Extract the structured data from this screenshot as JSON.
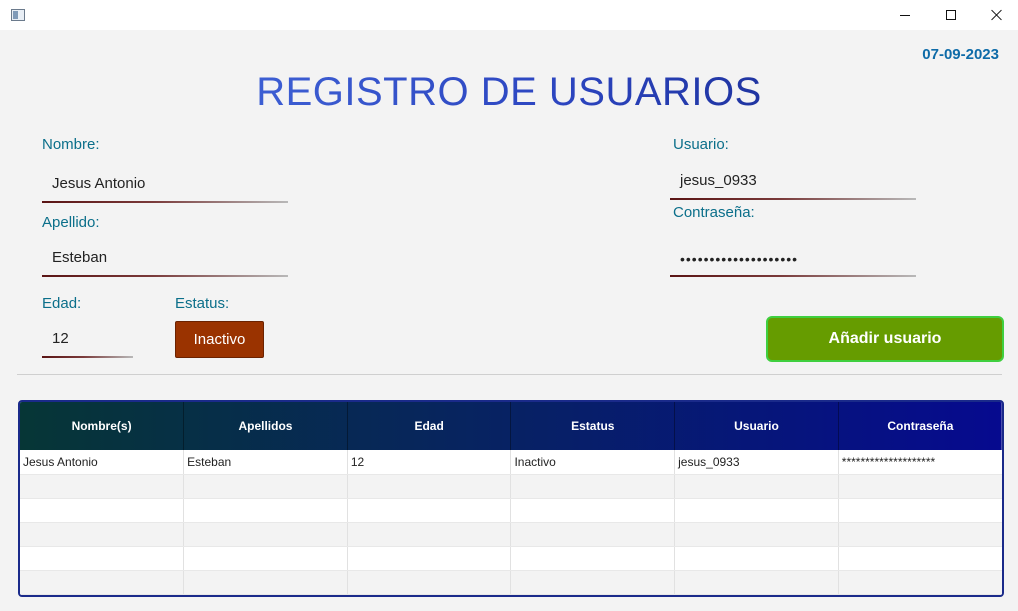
{
  "window": {
    "minimize_icon": "minimize-icon",
    "maximize_icon": "maximize-icon",
    "close_icon": "close-icon"
  },
  "header": {
    "date": "07-09-2023",
    "title": "REGISTRO DE USUARIOS"
  },
  "form": {
    "nombre_label": "Nombre:",
    "nombre_value": "Jesus Antonio",
    "apellido_label": "Apellido:",
    "apellido_value": "Esteban",
    "edad_label": "Edad:",
    "edad_value": "12",
    "estatus_label": "Estatus:",
    "estatus_value": "Inactivo",
    "usuario_label": "Usuario:",
    "usuario_value": "jesus_0933",
    "contrasena_label": "Contraseña:",
    "contrasena_value": "••••••••••••••••••••",
    "add_button": "Añadir usuario"
  },
  "colors": {
    "accent_blue": "#0e6ba8",
    "status_button": "#9a3300",
    "add_button": "#669c00"
  },
  "table": {
    "columns": [
      "Nombre(s)",
      "Apellidos",
      "Edad",
      "Estatus",
      "Usuario",
      "Contraseña"
    ],
    "rows": [
      [
        "Jesus Antonio",
        "Esteban",
        "12",
        "Inactivo",
        "jesus_0933",
        "********************"
      ],
      [
        "",
        "",
        "",
        "",
        "",
        ""
      ],
      [
        "",
        "",
        "",
        "",
        "",
        ""
      ],
      [
        "",
        "",
        "",
        "",
        "",
        ""
      ],
      [
        "",
        "",
        "",
        "",
        "",
        ""
      ],
      [
        "",
        "",
        "",
        "",
        "",
        ""
      ]
    ]
  }
}
